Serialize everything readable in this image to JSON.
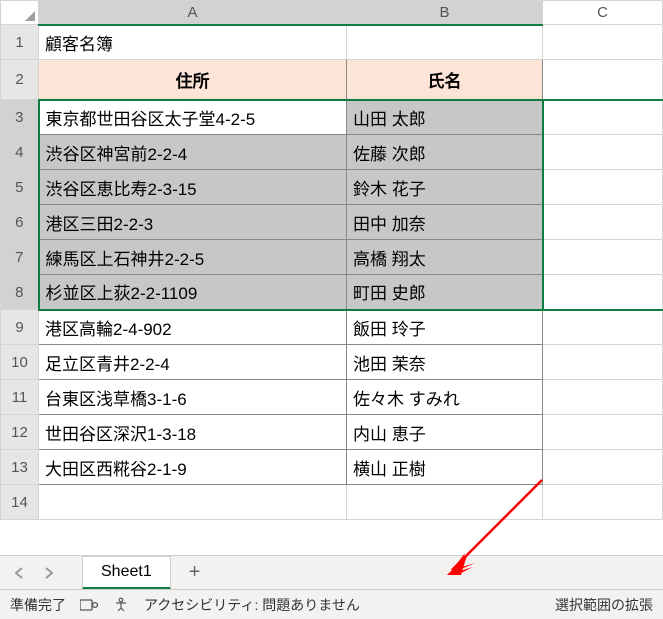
{
  "columns": [
    "A",
    "B",
    "C"
  ],
  "title": "顧客名簿",
  "headers": {
    "a": "住所",
    "b": "氏名"
  },
  "rows": [
    {
      "a": "東京都世田谷区太子堂4-2-5",
      "b": "山田 太郎"
    },
    {
      "a": "渋谷区神宮前2-2-4",
      "b": "佐藤 次郎"
    },
    {
      "a": "渋谷区恵比寿2-3-15",
      "b": "鈴木 花子"
    },
    {
      "a": "港区三田2-2-3",
      "b": "田中 加奈"
    },
    {
      "a": "練馬区上石神井2-2-5",
      "b": "高橋 翔太"
    },
    {
      "a": "杉並区上荻2-2-1109",
      "b": "町田 史郎"
    },
    {
      "a": "港区高輪2-4-902",
      "b": "飯田 玲子"
    },
    {
      "a": "足立区青井2-2-4",
      "b": "池田 茉奈"
    },
    {
      "a": "台東区浅草橋3-1-6",
      "b": "佐々木 すみれ"
    },
    {
      "a": "世田谷区深沢1-3-18",
      "b": "内山 恵子"
    },
    {
      "a": "大田区西糀谷2-1-9",
      "b": "横山 正樹"
    }
  ],
  "sheet_tab": "Sheet1",
  "status": {
    "ready": "準備完了",
    "accessibility": "アクセシビリティ: 問題ありません",
    "extend": "選択範囲の拡張"
  }
}
